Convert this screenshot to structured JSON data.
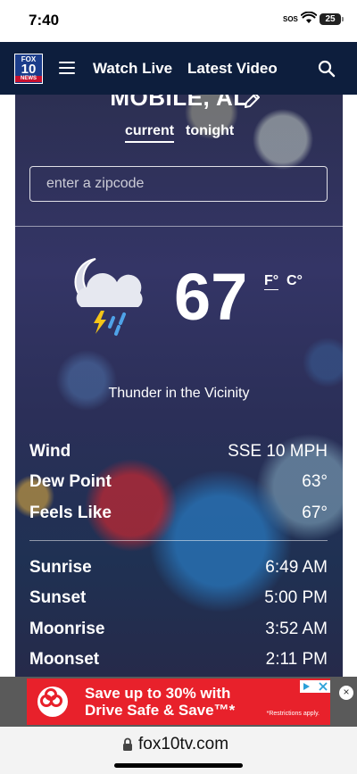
{
  "status_bar": {
    "time": "7:40",
    "sos": "SOS",
    "battery": "25",
    "icons": [
      "wifi-icon",
      "battery-icon"
    ]
  },
  "header": {
    "logo": {
      "top": "FOX",
      "number": "10",
      "bottom": "NEWS"
    },
    "nav": {
      "watch_live": "Watch Live",
      "latest_video": "Latest Video"
    },
    "icons": [
      "menu-icon",
      "search-icon"
    ],
    "brand_color": "#0d1e3d"
  },
  "weather": {
    "location": "MOBILE, AL",
    "tabs": [
      {
        "label": "current",
        "active": true
      },
      {
        "label": "tonight",
        "active": false
      }
    ],
    "zip_input": {
      "placeholder": "enter a zipcode",
      "value": ""
    },
    "icon": "thunderstorm-night-icon",
    "temperature": "67",
    "units": {
      "f": "F°",
      "c": "C°",
      "selected": "F°"
    },
    "condition": "Thunder in the Vicinity",
    "conditions": [
      {
        "label": "Wind",
        "value": "SSE 10 MPH"
      },
      {
        "label": "Dew Point",
        "value": "63°"
      },
      {
        "label": "Feels Like",
        "value": "67°"
      }
    ],
    "astronomy": [
      {
        "label": "Sunrise",
        "value": "6:49 AM"
      },
      {
        "label": "Sunset",
        "value": "5:00 PM"
      },
      {
        "label": "Moonrise",
        "value": "3:52 AM"
      },
      {
        "label": "Moonset",
        "value": "2:11 PM"
      }
    ]
  },
  "ad": {
    "line1": "Save up to 30% with",
    "line2": "Drive Safe & Save™*",
    "note": "*Restrictions apply.",
    "close": "×",
    "color": "#e8212b"
  },
  "browser": {
    "url": "fox10tv.com",
    "icons": [
      "lock-icon"
    ]
  }
}
